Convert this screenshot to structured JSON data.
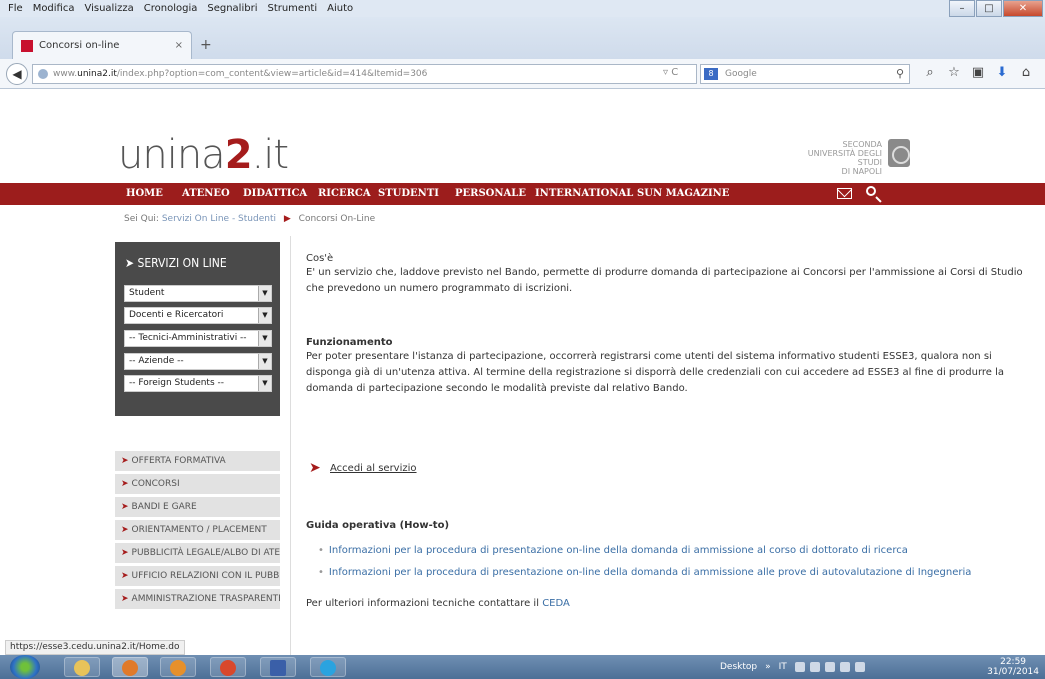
{
  "browser": {
    "menu": [
      "Fle",
      "Modifica",
      "Visualizza",
      "Cronologia",
      "Segnalibri",
      "Strumenti",
      "Aiuto"
    ],
    "tab_title": "Concorsi on-line",
    "url_prefix": "www.",
    "url_domain": "unina2.it",
    "url_rest": "/index.php?option=com_content&view=article&id=414&Itemid=306",
    "search_placeholder": "Google",
    "status_url": "https://esse3.cedu.unina2.it/Home.do"
  },
  "site": {
    "logo_text": "unina",
    "logo_bold": "2",
    "logo_tld": ".it",
    "univ_lines": [
      "SECONDA",
      "UNIVERSITÀ DEGLI STUDI",
      "DI NAPOLI"
    ],
    "nav": [
      "HOME",
      "ATENEO",
      "DIDATTICA",
      "RICERCA",
      "STUDENTI",
      "PERSONALE",
      "INTERNATIONAL",
      "SUN MAGAZINE"
    ],
    "breadcrumb_label": "Sei Qui:",
    "breadcrumb_link": "Servizi On Line - Studenti",
    "breadcrumb_current": "Concorsi On-Line"
  },
  "sidebar": {
    "title": "SERVIZI ON LINE",
    "selects": [
      "Student",
      "Docenti e Ricercatori",
      "-- Tecnici-Amministrativi --",
      "-- Aziende --",
      "-- Foreign Students --"
    ],
    "buttons": [
      "OFFERTA FORMATIVA",
      "CONCORSI",
      "BANDI E GARE",
      "ORIENTAMENTO / PLACEMENT",
      "PUBBLICITÀ LEGALE/ALBO DI ATENEO",
      "UFFICIO RELAZIONI CON IL PUBBLICO",
      "AMMINISTRAZIONE TRASPARENTE"
    ]
  },
  "content": {
    "cose_title": "Cos'è",
    "cose_line1": "E' un servizio che, laddove previsto nel Bando, permette di produrre domanda di partecipazione ai Concorsi per l'ammissione ai Corsi di Studio",
    "cose_line2": "che prevedono un numero programmato di iscrizioni.",
    "funz_title": "Funzionamento",
    "funz_line1": "Per poter presentare l'istanza di partecipazione, occorrerà registrarsi come utenti del sistema informativo studenti ESSE3, qualora non si",
    "funz_line2": "disponga già di un'utenza attiva. Al termine della registrazione si disporrà delle credenziali con cui accedere ad ESSE3 al fine di produrre la",
    "funz_line3": "domanda di partecipazione secondo le modalità previste dal relativo Bando.",
    "accedi": "Accedi al servizio",
    "guida_title": "Guida operativa (How-to)",
    "guida_link1": "Informazioni per la procedura di presentazione on-line della domanda di ammissione al corso di dottorato di ricerca",
    "guida_link2": "Informazioni per la procedura di presentazione on-line della domanda di ammissione alle prove di autovalutazione di Ingegneria",
    "footer_text": "Per ulteriori informazioni tecniche contattare il",
    "footer_link": "CEDA"
  },
  "taskbar": {
    "desktop": "Desktop",
    "lang": "IT",
    "time": "22:59",
    "date": "31/07/2014"
  }
}
